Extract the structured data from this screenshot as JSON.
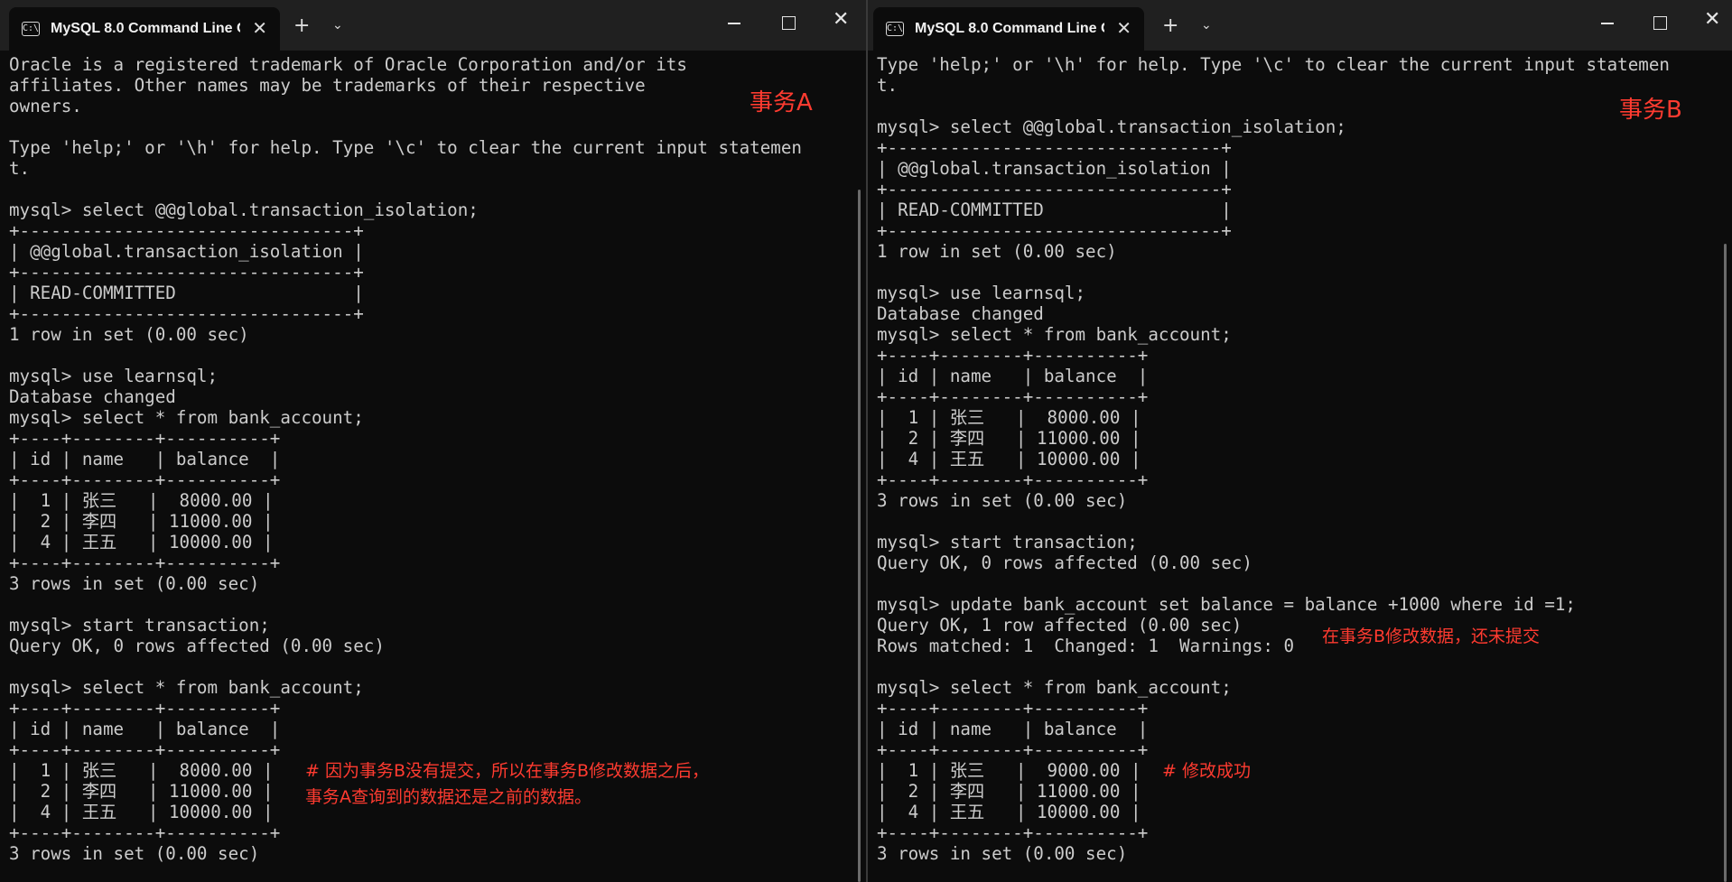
{
  "windowA": {
    "tab_title": "MySQL 8.0 Command Line C",
    "tab_icon": "C:\\",
    "lines": [
      "Oracle is a registered trademark of Oracle Corporation and/or its",
      "affiliates. Other names may be trademarks of their respective",
      "owners.",
      "",
      "Type 'help;' or '\\h' for help. Type '\\c' to clear the current input statemen",
      "t.",
      "",
      "mysql> select @@global.transaction_isolation;",
      "+--------------------------------+",
      "| @@global.transaction_isolation |",
      "+--------------------------------+",
      "| READ-COMMITTED                 |",
      "+--------------------------------+",
      "1 row in set (0.00 sec)",
      "",
      "mysql> use learnsql;",
      "Database changed",
      "mysql> select * from bank_account;",
      "+----+--------+----------+",
      "| id | name   | balance  |",
      "+----+--------+----------+",
      "|  1 | 张三   |  8000.00 |",
      "|  2 | 李四   | 11000.00 |",
      "|  4 | 王五   | 10000.00 |",
      "+----+--------+----------+",
      "3 rows in set (0.00 sec)",
      "",
      "mysql> start transaction;",
      "Query OK, 0 rows affected (0.00 sec)",
      "",
      "mysql> select * from bank_account;",
      "+----+--------+----------+",
      "| id | name   | balance  |",
      "+----+--------+----------+",
      "|  1 | 张三   |  8000.00 |",
      "|  2 | 李四   | 11000.00 |",
      "|  4 | 王五   | 10000.00 |",
      "+----+--------+----------+",
      "3 rows in set (0.00 sec)"
    ],
    "label": "事务A",
    "note_line1": "# 因为事务B没有提交，所以在事务B修改数据之后，",
    "note_line2": "事务A查询到的数据还是之前的数据。"
  },
  "windowB": {
    "tab_title": "MySQL 8.0 Command Line C",
    "tab_icon": "C:\\",
    "lines": [
      "Type 'help;' or '\\h' for help. Type '\\c' to clear the current input statemen",
      "t.",
      "",
      "mysql> select @@global.transaction_isolation;",
      "+--------------------------------+",
      "| @@global.transaction_isolation |",
      "+--------------------------------+",
      "| READ-COMMITTED                 |",
      "+--------------------------------+",
      "1 row in set (0.00 sec)",
      "",
      "mysql> use learnsql;",
      "Database changed",
      "mysql> select * from bank_account;",
      "+----+--------+----------+",
      "| id | name   | balance  |",
      "+----+--------+----------+",
      "|  1 | 张三   |  8000.00 |",
      "|  2 | 李四   | 11000.00 |",
      "|  4 | 王五   | 10000.00 |",
      "+----+--------+----------+",
      "3 rows in set (0.00 sec)",
      "",
      "mysql> start transaction;",
      "Query OK, 0 rows affected (0.00 sec)",
      "",
      "mysql> update bank_account set balance = balance +1000 where id =1;",
      "Query OK, 1 row affected (0.00 sec)",
      "Rows matched: 1  Changed: 1  Warnings: 0",
      "",
      "mysql> select * from bank_account;",
      "+----+--------+----------+",
      "| id | name   | balance  |",
      "+----+--------+----------+",
      "|  1 | 张三   |  9000.00 |",
      "|  2 | 李四   | 11000.00 |",
      "|  4 | 王五   | 10000.00 |",
      "+----+--------+----------+",
      "3 rows in set (0.00 sec)"
    ],
    "label": "事务B",
    "note_update": "在事务B修改数据，还未提交",
    "note_success": "# 修改成功"
  },
  "controls": {
    "new_tab": "+",
    "dropdown": "⌄",
    "close_tab": "✕",
    "close_window": "✕"
  },
  "colors": {
    "background": "#0c0c0c",
    "titlebar": "#202020",
    "text": "#cccccc",
    "annotation": "#ff3b30"
  }
}
